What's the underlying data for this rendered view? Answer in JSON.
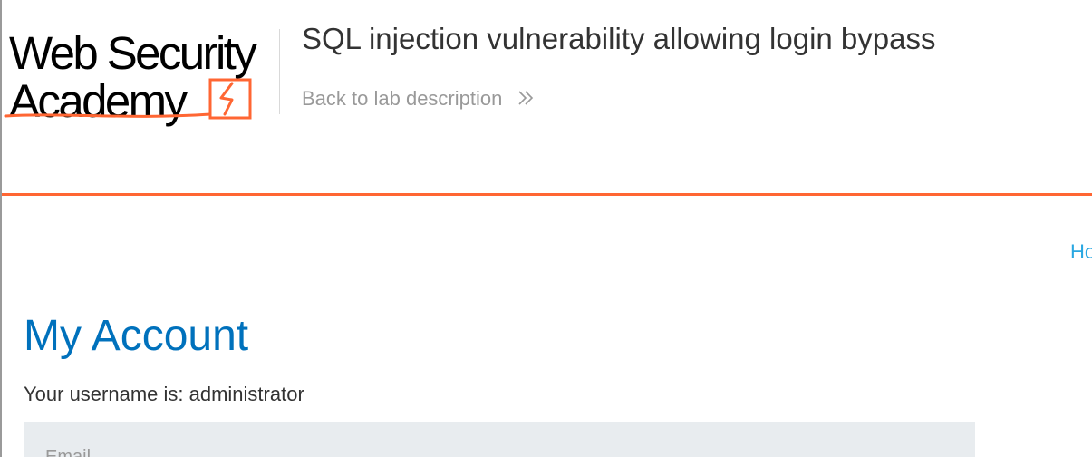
{
  "header": {
    "logo": {
      "line1": "Web Security",
      "line2": "Academy"
    },
    "lab_title": "SQL injection vulnerability allowing login bypass",
    "back_link": {
      "label": "Back to lab description",
      "icon": "double-chevron-right-icon"
    }
  },
  "nav": {
    "home_label": "Ho"
  },
  "main": {
    "title": "My Account",
    "username_text": "Your username is: administrator",
    "email_form": {
      "label": "Email"
    }
  },
  "colors": {
    "accent_orange": "#ff6633",
    "title_blue": "#0071bc",
    "link_blue": "#29a7e1",
    "muted_gray": "#999999",
    "form_bg": "#e8ecef"
  }
}
